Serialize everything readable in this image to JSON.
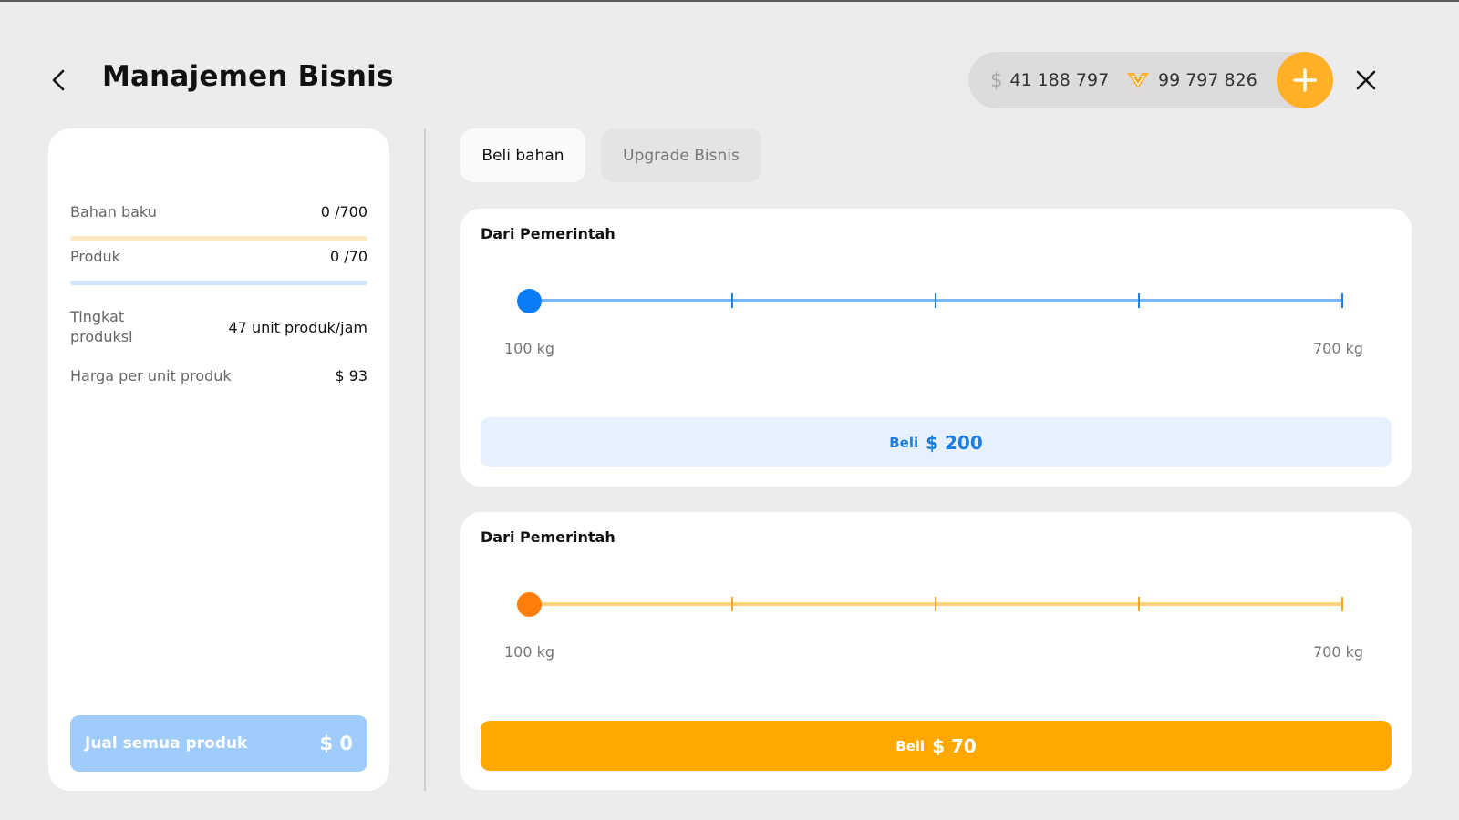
{
  "header": {
    "title": "Manajemen Bisnis",
    "cash_symbol": "$",
    "cash_value": "41 188 797",
    "gold_value": "99 797 826"
  },
  "colors": {
    "accent_orange": "#ffa900",
    "accent_blue": "#0a7cf6",
    "background": "#edebec"
  },
  "left_panel": {
    "raw_label": "Bahan baku",
    "raw_value": "0 /700",
    "raw_fill": 0,
    "product_label": "Produk",
    "product_value": "0 /70",
    "product_fill": 0,
    "rate_label": "Tingkat produksi",
    "rate_value": "47 unit produk/jam",
    "price_label": "Harga per unit produk",
    "price_value": "$ 93",
    "sell_label": "Jual semua produk",
    "sell_amount": "$ 0"
  },
  "tabs": [
    {
      "label": "Beli bahan",
      "active": true
    },
    {
      "label": "Upgrade Bisnis",
      "active": false
    }
  ],
  "cards": [
    {
      "title": "Dari Pemerintah",
      "min_label": "100 kg",
      "max_label": "700 kg",
      "slider_value": 0,
      "buy_label": "Beli",
      "buy_amount": "$ 200"
    },
    {
      "title": "Dari Pemerintah",
      "min_label": "100 kg",
      "max_label": "700 kg",
      "slider_value": 0,
      "buy_label": "Beli",
      "buy_amount": "$ 70"
    }
  ]
}
